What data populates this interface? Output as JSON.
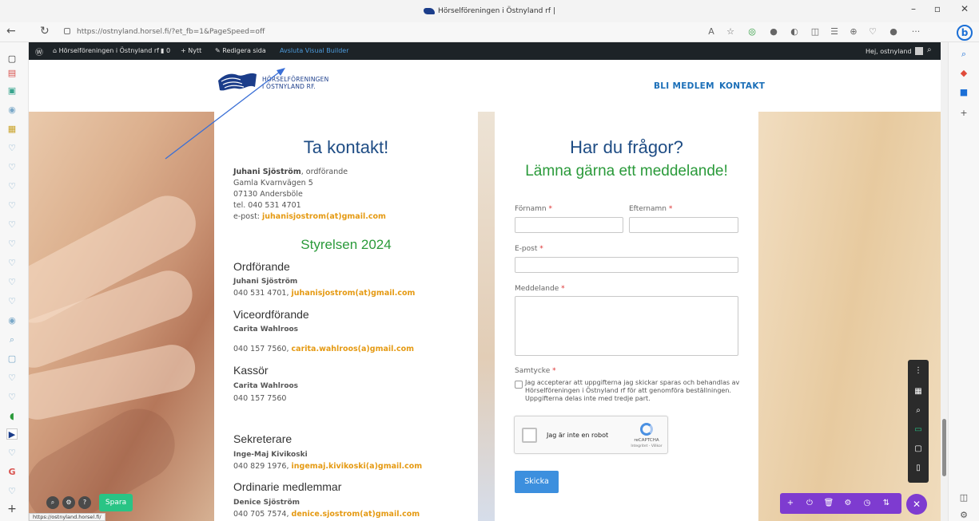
{
  "browser": {
    "window_title": "Hörselföreningen i Östnyland rf |",
    "url": "https://ostnyland.horsel.fi/?et_fb=1&PageSpeed=off",
    "status_url": "https://ostnyland.horsel.fi/"
  },
  "adminbar": {
    "site_name": "Hörselföreningen i Östnyland rf",
    "comments_count": "0",
    "new_label": "Nytt",
    "edit_label": "Redigera sida",
    "exit_builder": "Avsluta Visual Builder",
    "greeting": "Hej, ostnyland"
  },
  "header": {
    "logo_line1": "HÖRSELFÖRENINGEN",
    "logo_line2": "I ÖSTNYLAND RF.",
    "nav": [
      "BLI MEDLEM",
      "KONTAKT"
    ]
  },
  "contact": {
    "title": "Ta kontakt!",
    "name": "Juhani Sjöström",
    "role_suffix": ", ordförande",
    "address1": "Gamla Kvarnvägen 5",
    "address2": "07130 Andersböle",
    "phone": "tel. 040 531 4701",
    "email_prefix": "e-post: ",
    "email": "juhanisjostrom(at)gmail.com"
  },
  "board": {
    "title": "Styrelsen 2024",
    "roles": [
      {
        "role": "Ordförande",
        "name": "Juhani Sjöström",
        "phone": "040 531 4701, ",
        "email": "juhanisjostrom(at)gmail.com"
      },
      {
        "role": "Viceordförande",
        "name": "Carita Wahlroos",
        "phone": "040 157 7560, ",
        "email": "carita.wahlroos(a)gmail.com"
      },
      {
        "role": "Kassör",
        "name": "Carita Wahlroos",
        "phone": "040 157 7560",
        "email": ""
      },
      {
        "role": "Sekreterare",
        "name": "Inge-Maj Kivikoski",
        "phone": "040 829 1976, ",
        "email": "ingemaj.kivikoski(a)gmail.com"
      },
      {
        "role": "Ordinarie medlemmar",
        "name": "Denice Sjöström",
        "phone": "040 705 7574, ",
        "email": "denice.sjostrom(at)gmail.com"
      }
    ]
  },
  "form": {
    "title": "Har du frågor?",
    "subtitle": "Lämna gärna ett meddelande!",
    "firstname_label": "Förnamn",
    "lastname_label": "Efternamn",
    "email_label": "E-post",
    "message_label": "Meddelande",
    "required_mark": "*",
    "consent_label": "Samtycke",
    "consent_text": "Jag accepterar att uppgifterna jag skickar sparas och behandlas av Hörselföreningen i Östnyland rf för att genomföra beställningen. Uppgifterna delas inte med tredje part.",
    "recaptcha_label": "Jag är inte en robot",
    "recaptcha_brand": "reCAPTCHA",
    "recaptcha_sub": "Integritet - Villkor",
    "submit": "Skicka"
  },
  "divi": {
    "save": "Spara"
  },
  "colors": {
    "heading_blue": "#1e4c84",
    "heading_green": "#2a9a3a",
    "link_orange": "#e59a13",
    "nav_blue": "#1b6fb8",
    "divi_purple": "#7e3bd0",
    "save_green": "#29c485"
  }
}
